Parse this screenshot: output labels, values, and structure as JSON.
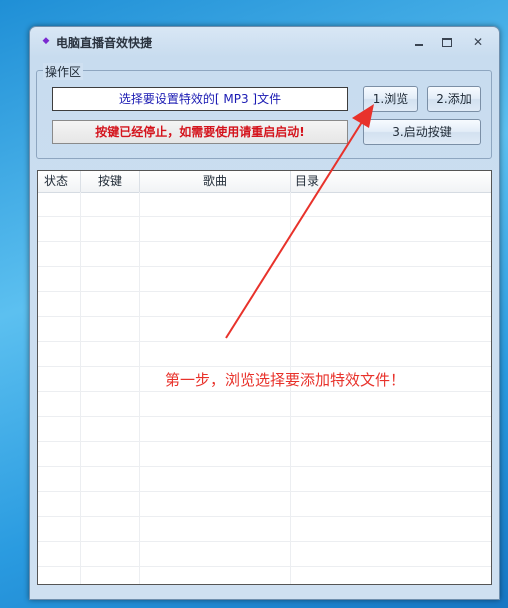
{
  "window": {
    "title": "电脑直播音效快捷",
    "app_icon": "app-logo-icon",
    "controls": {
      "minimize": "minimize-icon",
      "maximize": "maximize-icon",
      "close": "✕"
    }
  },
  "operations": {
    "group_label": "操作区",
    "file_display": "选择要设置特效的[ MP3 ]文件",
    "status_message": "按键已经停止，如需要使用请重启启动!",
    "buttons": {
      "browse": "1.浏览",
      "add": "2.添加",
      "start": "3.启动按键"
    }
  },
  "list": {
    "columns": [
      "状态",
      "按键",
      "歌曲",
      "目录"
    ],
    "rows": []
  },
  "annotation": {
    "text": "第一步，浏览选择要添加特效文件！",
    "color": "#e8322b"
  },
  "colors": {
    "status_text": "#d4141d",
    "file_text": "#1b1bb3"
  }
}
